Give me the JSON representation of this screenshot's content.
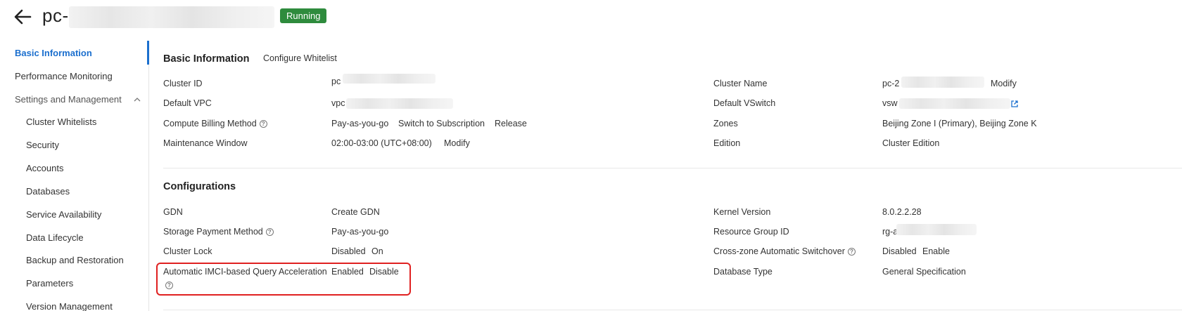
{
  "header": {
    "title": "pc-",
    "status": "Running"
  },
  "sidebar": {
    "items": [
      {
        "label": "Basic Information"
      },
      {
        "label": "Performance Monitoring"
      },
      {
        "label": "Settings and Management"
      },
      {
        "label": "Cluster Whitelists"
      },
      {
        "label": "Security"
      },
      {
        "label": "Accounts"
      },
      {
        "label": "Databases"
      },
      {
        "label": "Service Availability"
      },
      {
        "label": "Data Lifecycle"
      },
      {
        "label": "Backup and Restoration"
      },
      {
        "label": "Parameters"
      },
      {
        "label": "Version Management"
      }
    ]
  },
  "basic": {
    "title": "Basic Information",
    "configure_whitelist": "Configure Whitelist",
    "cluster_id_label": "Cluster ID",
    "cluster_id_value": "pc",
    "default_vpc_label": "Default VPC",
    "default_vpc_value": "vpc",
    "billing_label": "Compute Billing Method",
    "billing_value": "Pay-as-you-go",
    "switch_subscription": "Switch to Subscription",
    "release": "Release",
    "maintenance_label": "Maintenance Window",
    "maintenance_value": "02:00-03:00 (UTC+08:00)",
    "maintenance_modify": "Modify",
    "cluster_name_label": "Cluster Name",
    "cluster_name_value": "pc-2",
    "cluster_name_modify": "Modify",
    "vswitch_label": "Default VSwitch",
    "vswitch_value": "vsw",
    "zones_label": "Zones",
    "zones_value": "Beijing Zone I (Primary), Beijing Zone K",
    "edition_label": "Edition",
    "edition_value": "Cluster Edition"
  },
  "config": {
    "title": "Configurations",
    "gdn_label": "GDN",
    "gdn_value": "Create GDN",
    "storage_label": "Storage Payment Method",
    "storage_value": "Pay-as-you-go",
    "lock_label": "Cluster Lock",
    "lock_value": "Disabled",
    "lock_action": "On",
    "imci_label": "Automatic IMCI-based Query Acceleration",
    "imci_value": "Enabled",
    "imci_action": "Disable",
    "kernel_label": "Kernel Version",
    "kernel_value": "8.0.2.2.28",
    "rg_label": "Resource Group ID",
    "rg_value": "rg-a",
    "crosszone_label": "Cross-zone Automatic Switchover",
    "crosszone_value": "Disabled",
    "crosszone_action": "Enable",
    "dbtype_label": "Database Type",
    "dbtype_value": "General Specification"
  },
  "colors": {
    "accent": "#1b6fce",
    "status_green": "#2e8b3d",
    "highlight_red": "#e02020"
  },
  "icons": {
    "back": "arrow-left-icon",
    "help": "help-circle-icon",
    "chevron": "chevron-up-icon",
    "external": "external-link-icon"
  }
}
